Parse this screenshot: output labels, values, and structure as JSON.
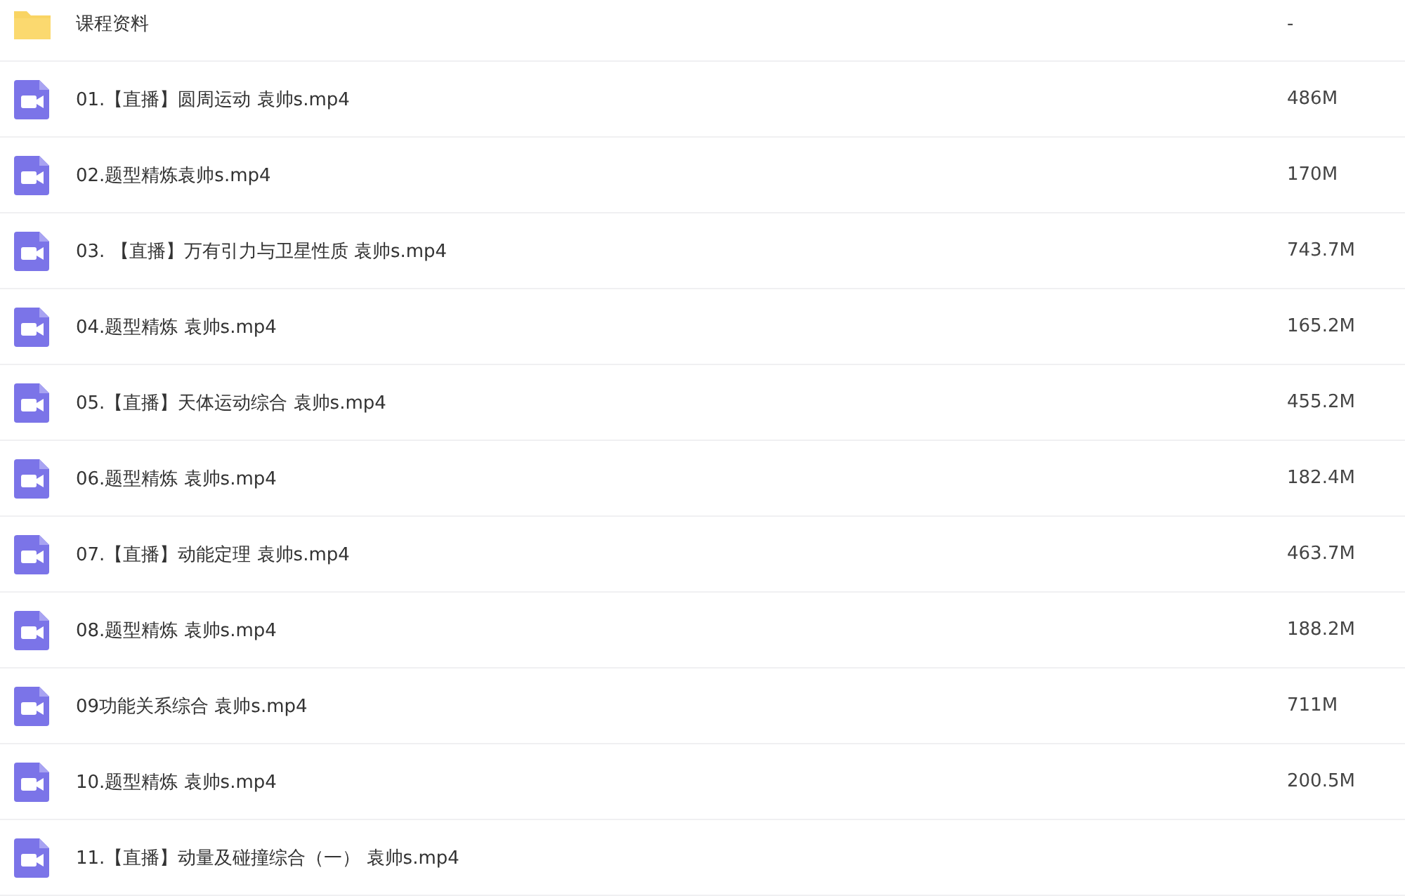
{
  "files": [
    {
      "kind": "folder",
      "name": "课程资料",
      "size": "-"
    },
    {
      "kind": "video",
      "name": "01.【直播】圆周运动 袁帅s.mp4",
      "size": "486M"
    },
    {
      "kind": "video",
      "name": "02.题型精炼袁帅s.mp4",
      "size": "170M"
    },
    {
      "kind": "video",
      "name": "03. 【直播】万有引力与卫星性质 袁帅s.mp4",
      "size": "743.7M"
    },
    {
      "kind": "video",
      "name": "04.题型精炼 袁帅s.mp4",
      "size": "165.2M"
    },
    {
      "kind": "video",
      "name": "05.【直播】天体运动综合 袁帅s.mp4",
      "size": "455.2M"
    },
    {
      "kind": "video",
      "name": "06.题型精炼 袁帅s.mp4",
      "size": "182.4M"
    },
    {
      "kind": "video",
      "name": "07.【直播】动能定理 袁帅s.mp4",
      "size": "463.7M"
    },
    {
      "kind": "video",
      "name": "08.题型精炼 袁帅s.mp4",
      "size": "188.2M"
    },
    {
      "kind": "video",
      "name": "09功能关系综合 袁帅s.mp4",
      "size": "711M"
    },
    {
      "kind": "video",
      "name": "10.题型精炼 袁帅s.mp4",
      "size": "200.5M"
    },
    {
      "kind": "video",
      "name": "11.【直播】动量及碰撞综合（一） 袁帅s.mp4"
    }
  ]
}
